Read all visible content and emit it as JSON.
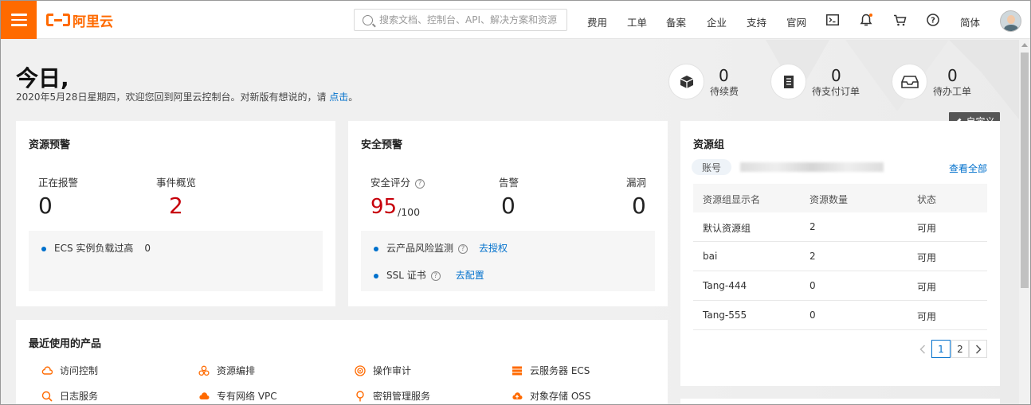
{
  "topbar": {
    "logo_text": "阿里云",
    "search_placeholder": "搜索文档、控制台、API、解决方案和资源",
    "nav": [
      "费用",
      "工单",
      "备案",
      "企业",
      "支持",
      "官网"
    ],
    "lang": "简体"
  },
  "header": {
    "greeting": "今日,",
    "subtitle_prefix": "2020年5月28日星期四，欢迎您回到阿里云控制台。对新版有想说的，请 ",
    "subtitle_link": "点击",
    "subtitle_suffix": "。",
    "stats": [
      {
        "value": "0",
        "label": "待续费",
        "icon": "box-icon"
      },
      {
        "value": "0",
        "label": "待支付订单",
        "icon": "order-icon"
      },
      {
        "value": "0",
        "label": "待办工单",
        "icon": "inbox-icon"
      }
    ],
    "customize_label": "自定义"
  },
  "resource_alert": {
    "title": "资源预警",
    "alarm_label": "正在报警",
    "alarm_value": "0",
    "event_label": "事件概览",
    "event_value": "2",
    "row_label": "ECS 实例负载过高",
    "row_value": "0"
  },
  "security_alert": {
    "title": "安全预警",
    "score_label": "安全评分",
    "score_value": "95",
    "score_max": "/100",
    "alarm_label": "告警",
    "alarm_value": "0",
    "vuln_label": "漏洞",
    "vuln_value": "0",
    "rows": [
      {
        "label": "云产品风险监测",
        "action": "去授权"
      },
      {
        "label": "SSL 证书",
        "action": "去配置"
      }
    ]
  },
  "resource_group": {
    "title": "资源组",
    "tag": "账号",
    "view_all": "查看全部",
    "columns": [
      "资源组显示名",
      "资源数量",
      "状态"
    ],
    "rows": [
      {
        "name": "默认资源组",
        "count": "2",
        "status": "可用"
      },
      {
        "name": "bai",
        "count": "2",
        "status": "可用"
      },
      {
        "name": "Tang-444",
        "count": "0",
        "status": "可用"
      },
      {
        "name": "Tang-555",
        "count": "0",
        "status": "可用"
      }
    ],
    "pages": [
      "1",
      "2"
    ]
  },
  "recent_products": {
    "title": "最近使用的产品",
    "items": [
      {
        "label": "访问控制",
        "icon": "cloud-icon"
      },
      {
        "label": "资源编排",
        "icon": "nodes-icon"
      },
      {
        "label": "操作审计",
        "icon": "audit-icon"
      },
      {
        "label": "云服务器 ECS",
        "icon": "server-icon"
      },
      {
        "label": "日志服务",
        "icon": "log-icon"
      },
      {
        "label": "专有网络 VPC",
        "icon": "vpc-icon"
      },
      {
        "label": "密钥管理服务",
        "icon": "key-icon"
      },
      {
        "label": "对象存储 OSS",
        "icon": "storage-icon"
      }
    ]
  },
  "colors": {
    "brand": "#ff6a00",
    "link": "#0070cc",
    "alert_red": "#c7000b"
  }
}
